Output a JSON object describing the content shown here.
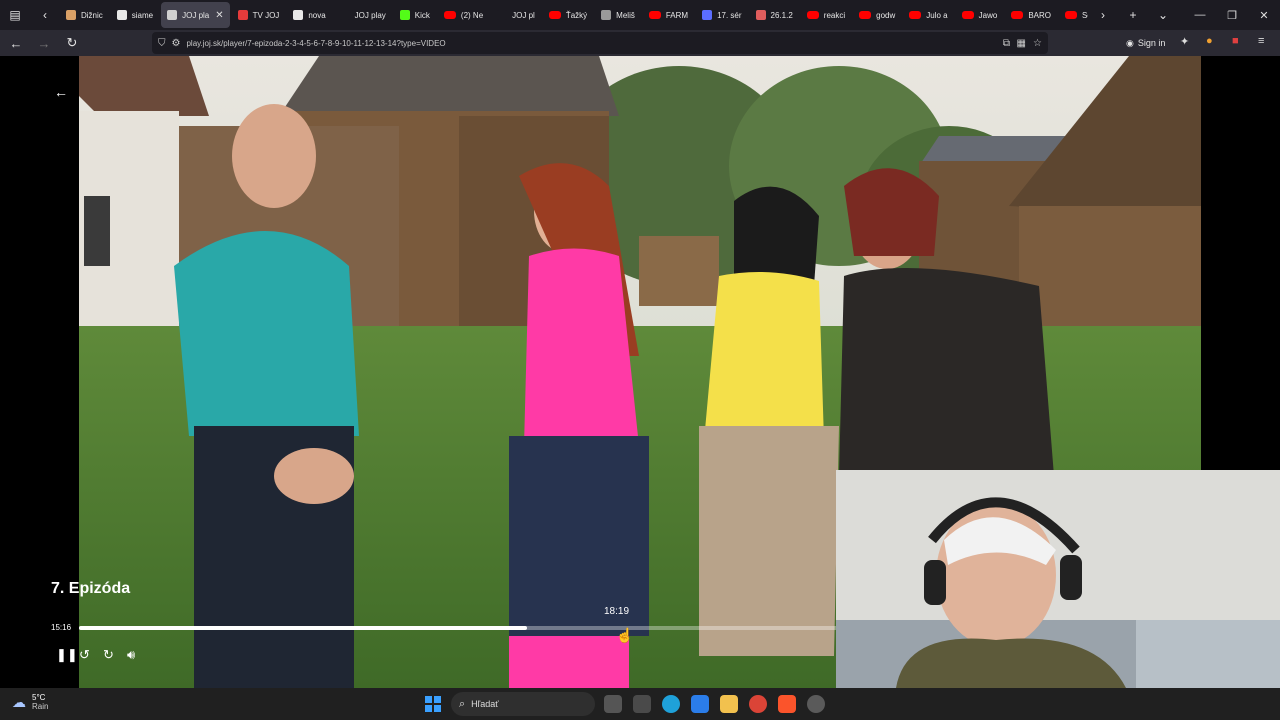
{
  "browser": {
    "tabs": [
      {
        "label": "Dižnic",
        "fav": "#d9a066",
        "active": false
      },
      {
        "label": "siame",
        "fav": "#e8e8e8",
        "active": false
      },
      {
        "label": "JOJ pla",
        "fav": "#d0d0d0",
        "active": true
      },
      {
        "label": "TV JOJ",
        "fav": "#e63b3b",
        "active": false
      },
      {
        "label": "nova",
        "fav": "#e8e8e8",
        "active": false
      },
      {
        "label": "JOJ play",
        "fav": "#1c1b22",
        "active": false
      },
      {
        "label": "Kick",
        "fav": "#53fc18",
        "active": false
      },
      {
        "label": "(2) Ne",
        "fav": "yt",
        "active": false
      },
      {
        "label": "JOJ pl",
        "fav": "#1c1b22",
        "active": false
      },
      {
        "label": "Ťažký",
        "fav": "yt",
        "active": false
      },
      {
        "label": "Meliš",
        "fav": "#9a9a9a",
        "active": false
      },
      {
        "label": "FARM",
        "fav": "yt",
        "active": false
      },
      {
        "label": "17. sér",
        "fav": "#5b6dff",
        "active": false
      },
      {
        "label": "26.1.2",
        "fav": "#e05d5d",
        "active": false
      },
      {
        "label": "reakci",
        "fav": "yt",
        "active": false
      },
      {
        "label": "godw",
        "fav": "yt",
        "active": false
      },
      {
        "label": "Julo a",
        "fav": "yt",
        "active": false
      },
      {
        "label": "Jawo",
        "fav": "yt",
        "active": false
      },
      {
        "label": "BARO",
        "fav": "yt",
        "active": false
      },
      {
        "label": "So Pa",
        "fav": "yt",
        "active": false
      }
    ],
    "url": "play.joj.sk/player/7-epizoda-2-3-4-5-6-7-8-9-10-11-12-13-14?type=VIDEO",
    "signin_label": "Sign in"
  },
  "player": {
    "episode_title": "7. Epizóda",
    "current_time": "15:16",
    "hover_time": "18:19",
    "progress_fraction": 0.59
  },
  "taskbar": {
    "temperature": "5°C",
    "condition": "Rain",
    "search_placeholder": "Hľadať"
  },
  "icons": {
    "back": "arrow-left-icon",
    "pause": "pause-icon",
    "rewind": "rewind-icon",
    "forward": "forward-icon",
    "volume": "volume-icon"
  }
}
